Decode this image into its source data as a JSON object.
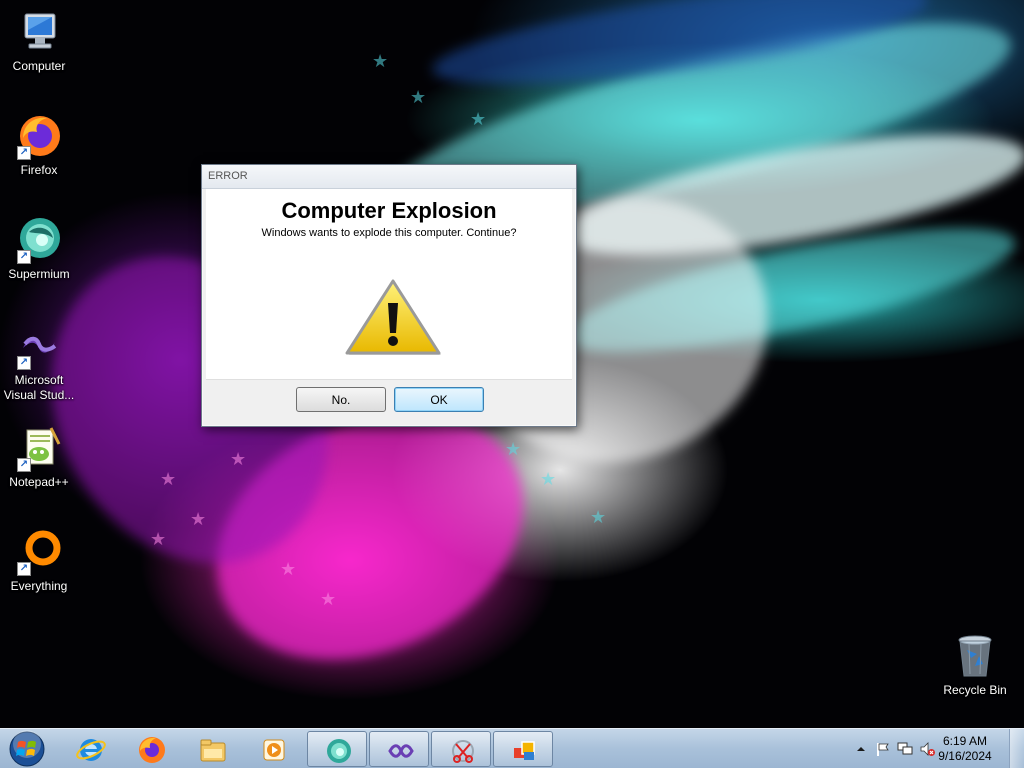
{
  "desktop": {
    "icons": [
      {
        "label": "Computer",
        "icon": "computer-icon"
      },
      {
        "label": "Firefox",
        "icon": "firefox-icon"
      },
      {
        "label": "Supermium",
        "icon": "supermium-icon"
      },
      {
        "label": "Microsoft Visual Stud...",
        "icon": "visual-studio-icon"
      },
      {
        "label": "Notepad++",
        "icon": "notepadpp-icon"
      },
      {
        "label": "Everything",
        "icon": "everything-icon"
      },
      {
        "label": "Recycle Bin",
        "icon": "recycle-bin-icon"
      }
    ]
  },
  "dialog": {
    "title": "ERROR",
    "heading": "Computer Explosion",
    "message": "Windows wants to explode this computer. Continue?",
    "icon": "warning-icon",
    "buttons": {
      "no": "No.",
      "ok": "OK"
    }
  },
  "taskbar": {
    "start_icon": "windows-start-orb",
    "items": [
      {
        "icon": "internet-explorer-icon",
        "running": false
      },
      {
        "icon": "firefox-icon",
        "running": false
      },
      {
        "icon": "file-explorer-icon",
        "running": false
      },
      {
        "icon": "media-player-icon",
        "running": false
      },
      {
        "icon": "supermium-icon",
        "running": true
      },
      {
        "icon": "visual-studio-icon",
        "running": true
      },
      {
        "icon": "snipping-tool-icon",
        "running": true
      },
      {
        "icon": "winforms-app-icon",
        "running": true
      }
    ],
    "tray": {
      "icons": [
        "show-hidden-icons-arrow",
        "action-center-flag-icon",
        "network-icon",
        "volume-muted-icon"
      ],
      "time": "6:19 AM",
      "date": "9/16/2024"
    }
  },
  "colors": {
    "dialog_bg": "#f0f0f0",
    "taskbar": "#a9c1da",
    "default_button": "#bee6fd",
    "warning_yellow": "#f5d90a"
  }
}
